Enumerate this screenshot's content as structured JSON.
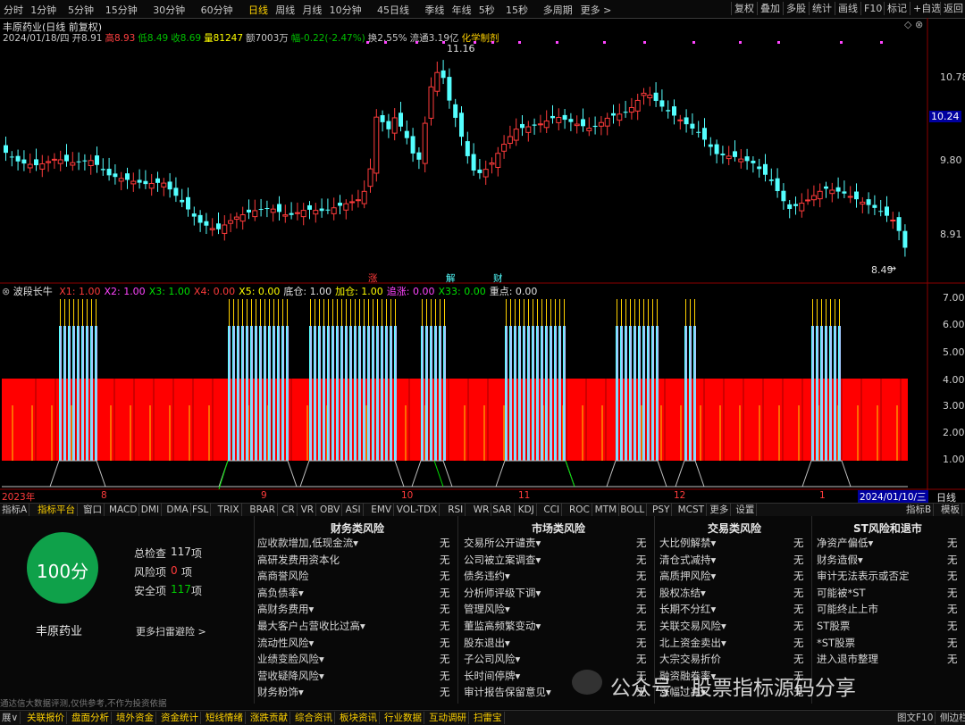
{
  "toolbar": {
    "periods": [
      "分时",
      "1分钟",
      "5分钟",
      "15分钟",
      "30分钟",
      "60分钟",
      "日线",
      "周线",
      "月线",
      "10分钟",
      "45日线",
      "季线",
      "年线",
      "5秒",
      "15秒",
      "多周期",
      "更多 >"
    ],
    "active_period": "日线",
    "right_buttons": [
      "复权",
      "叠加",
      "多股",
      "统计",
      "画线",
      "F10",
      "标记",
      "+自选",
      "返回"
    ]
  },
  "quote": {
    "title": "丰原药业(日线 前复权)",
    "line": [
      {
        "t": "2024/01/18/四",
        "c": "#c8c8c8"
      },
      {
        "t": "开8.91",
        "c": "#c8c8c8"
      },
      {
        "t": "高8.93",
        "c": "#ff4040"
      },
      {
        "t": "低8.49",
        "c": "#00c000"
      },
      {
        "t": "收8.69",
        "c": "#00c000"
      },
      {
        "t": "量81247",
        "c": "#ffff00"
      },
      {
        "t": "额7003万",
        "c": "#c8c8c8"
      },
      {
        "t": "幅-0.22(-2.47%)",
        "c": "#00c000"
      },
      {
        "t": "换2.55%",
        "c": "#c8c8c8"
      },
      {
        "t": "流通3.19亿",
        "c": "#c8c8c8"
      },
      {
        "t": "化学制剂",
        "c": "#ffd200"
      }
    ]
  },
  "price_axis": {
    "labels": [
      "10.78",
      "9.80",
      "8.91"
    ],
    "current": "10.24"
  },
  "price_annotations": {
    "high": "11.16",
    "low": "8.49"
  },
  "event_markers": [
    "涨",
    "解",
    "财"
  ],
  "colors": {
    "up": "#ff3b3b",
    "down": "#54ffff",
    "bg": "#000000",
    "accent": "#ffd200",
    "panel_red": "#ff0000"
  },
  "indicator": {
    "name": "波段长牛",
    "params": [
      {
        "t": "X1: 1.00",
        "c": "#ff3b3b"
      },
      {
        "t": "X2: 1.00",
        "c": "#ff44ff"
      },
      {
        "t": "X3: 1.00",
        "c": "#00e000"
      },
      {
        "t": "X4: 0.00",
        "c": "#ff3b3b"
      },
      {
        "t": "X5: 0.00",
        "c": "#ffff00"
      },
      {
        "t": "底仓: 1.00",
        "c": "#e0e0e0"
      },
      {
        "t": "加仓: 1.00",
        "c": "#ffff00"
      },
      {
        "t": "追涨: 0.00",
        "c": "#ff44ff"
      },
      {
        "t": "X33: 0.00",
        "c": "#00e000"
      },
      {
        "t": "重点: 0.00",
        "c": "#e0e0e0"
      }
    ],
    "axis": [
      "7.00",
      "6.00",
      "5.00",
      "4.00",
      "3.00",
      "2.00",
      "1.00"
    ]
  },
  "date_axis": {
    "labels": [
      "2023年",
      "8",
      "9",
      "10",
      "11",
      "12",
      "1"
    ],
    "current": "2024/01/10/三",
    "period": "日线"
  },
  "indicator_tabs": [
    "指标A",
    "指标平台",
    "窗口",
    "MACD",
    "DMI",
    "DMA",
    "FSL",
    "TRIX",
    "BRAR",
    "CR",
    "VR",
    "OBV",
    "ASI",
    "EMV",
    "VOL-TDX",
    "RSI",
    "WR",
    "SAR",
    "KDJ",
    "CCI",
    "ROC",
    "MTM",
    "BOLL",
    "PSY",
    "MCST",
    "更多",
    "设置"
  ],
  "indicator_tabs_right": [
    "指标B",
    "模板"
  ],
  "score": {
    "value": "100分",
    "stock": "丰原药业",
    "stats": [
      {
        "label": "总检查",
        "value": "117",
        "unit": "项",
        "color": "#e0e0e0"
      },
      {
        "label": "风险项",
        "value": "0",
        "unit": "项",
        "color": "#ff3b3b"
      },
      {
        "label": "安全项",
        "value": "117",
        "unit": "项",
        "color": "#00d000"
      }
    ],
    "more": "更多扫雷避险 >",
    "disclaimer": "通达信大数据评测,仅供参考,不作为投资依据"
  },
  "risk_columns": [
    {
      "title": "财务类风险",
      "items": [
        {
          "name": "应收款增加,低现金流▾",
          "status": "无"
        },
        {
          "name": "高研发费用资本化",
          "status": "无"
        },
        {
          "name": "高商誉风险",
          "status": "无"
        },
        {
          "name": "高负债率▾",
          "status": "无"
        },
        {
          "name": "高财务费用▾",
          "status": "无"
        },
        {
          "name": "最大客户占营收比过高▾",
          "status": "无"
        },
        {
          "name": "流动性风险▾",
          "status": "无"
        },
        {
          "name": "业绩变脸风险▾",
          "status": "无"
        },
        {
          "name": "营收疑降风险▾",
          "status": "无"
        },
        {
          "name": "财务粉饰▾",
          "status": "无"
        }
      ]
    },
    {
      "title": "市场类风险",
      "items": [
        {
          "name": "交易所公开谴责▾",
          "status": "无"
        },
        {
          "name": "公司被立案调查▾",
          "status": "无"
        },
        {
          "name": "债务违约▾",
          "status": "无"
        },
        {
          "name": "分析师评级下调▾",
          "status": "无"
        },
        {
          "name": "管理风险▾",
          "status": "无"
        },
        {
          "name": "董监高频繁变动▾",
          "status": "无"
        },
        {
          "name": "股东退出▾",
          "status": "无"
        },
        {
          "name": "子公司风险▾",
          "status": "无"
        },
        {
          "name": "长时间停牌▾",
          "status": "无"
        },
        {
          "name": "审计报告保留意见▾",
          "status": "无"
        }
      ]
    },
    {
      "title": "交易类风险",
      "items": [
        {
          "name": "大比例解禁▾",
          "status": "无"
        },
        {
          "name": "清仓式减持▾",
          "status": "无"
        },
        {
          "name": "高质押风险▾",
          "status": "无"
        },
        {
          "name": "股权冻结▾",
          "status": "无"
        },
        {
          "name": "长期不分红▾",
          "status": "无"
        },
        {
          "name": "关联交易风险▾",
          "status": "无"
        },
        {
          "name": "北上资金卖出▾",
          "status": "无"
        },
        {
          "name": "大宗交易折价",
          "status": "无"
        },
        {
          "name": "融资融券率▾",
          "status": "无"
        },
        {
          "name": "涨幅过高▾",
          "status": "无"
        }
      ]
    },
    {
      "title": "ST风险和退市",
      "items": [
        {
          "name": "净资产偏低▾",
          "status": "无"
        },
        {
          "name": "财务造假▾",
          "status": "无"
        },
        {
          "name": "审计无法表示或否定",
          "status": "无"
        },
        {
          "name": "可能被*ST",
          "status": "无"
        },
        {
          "name": "可能终止上市",
          "status": "无"
        },
        {
          "name": "ST股票",
          "status": "无"
        },
        {
          "name": "*ST股票",
          "status": "无"
        },
        {
          "name": "进入退市整理",
          "status": "无"
        }
      ]
    }
  ],
  "watermark": "公众号 · 股票指标源码分享",
  "bottom_tabs": [
    "展∨",
    "关联报价",
    "盘面分析",
    "境外资金",
    "资金统计",
    "短线情绪",
    "涨跌贡献",
    "综合资讯",
    "板块资讯",
    "行业数据",
    "互动调研",
    "扫雷宝"
  ],
  "bottom_right": [
    "图文F10",
    "侧边栏>"
  ]
}
